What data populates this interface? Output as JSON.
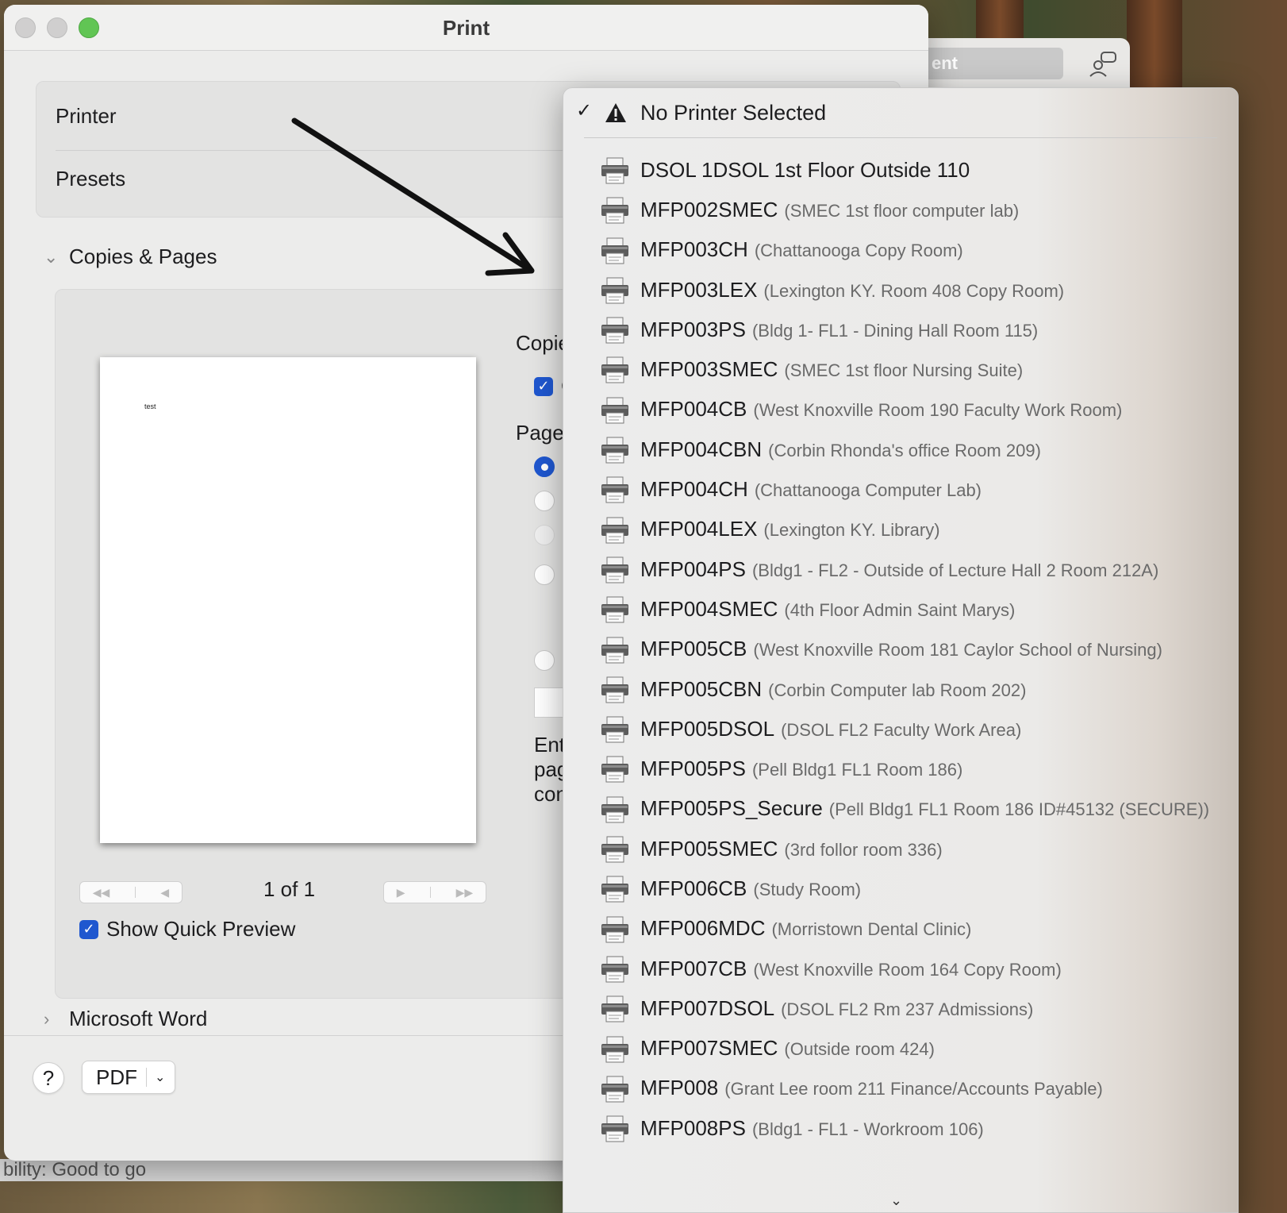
{
  "background": {
    "window_field_text": "ent",
    "status_text": "bility: Good to go"
  },
  "dialog": {
    "title": "Print",
    "printer_label": "Printer",
    "presets_label": "Presets",
    "copies_pages_label": "Copies & Pages",
    "copies_label_partial": "Copie",
    "collate_partial": "C",
    "pages_label_partial": "Pages",
    "enter_text_partial": [
      "Ent",
      "pag",
      "con"
    ],
    "preview_text": "test",
    "page_counter": "1 of 1",
    "show_quick_preview": "Show Quick Preview",
    "microsoft_word_label": "Microsoft Word",
    "help_label": "?",
    "pdf_label": "PDF"
  },
  "menu": {
    "header": "No Printer Selected",
    "items": [
      {
        "name": "DSOL 1DSOL 1st Floor Outside 110",
        "desc": ""
      },
      {
        "name": "MFP002SMEC",
        "desc": "(SMEC 1st floor computer lab)"
      },
      {
        "name": "MFP003CH",
        "desc": "(Chattanooga Copy Room)"
      },
      {
        "name": "MFP003LEX",
        "desc": "(Lexington KY.  Room 408 Copy Room)"
      },
      {
        "name": "MFP003PS",
        "desc": "(Bldg 1- FL1 - Dining Hall Room 115)"
      },
      {
        "name": "MFP003SMEC",
        "desc": "(SMEC 1st floor Nursing Suite)"
      },
      {
        "name": "MFP004CB",
        "desc": "(West Knoxville     Room 190  Faculty Work Room)"
      },
      {
        "name": "MFP004CBN",
        "desc": "(Corbin Rhonda's office Room 209)"
      },
      {
        "name": "MFP004CH",
        "desc": "(Chattanooga Computer Lab)"
      },
      {
        "name": "MFP004LEX",
        "desc": "(Lexington KY.  Library)"
      },
      {
        "name": "MFP004PS",
        "desc": "(Bldg1 - FL2 -  Outside of Lecture Hall 2 Room 212A)"
      },
      {
        "name": "MFP004SMEC",
        "desc": "(4th Floor Admin Saint Marys)"
      },
      {
        "name": "MFP005CB",
        "desc": "(West Knoxville     Room 181  Caylor School of Nursing)"
      },
      {
        "name": "MFP005CBN",
        "desc": "(Corbin Computer lab Room 202)"
      },
      {
        "name": "MFP005DSOL",
        "desc": "(DSOL FL2 Faculty Work Area)"
      },
      {
        "name": "MFP005PS",
        "desc": "(Pell Bldg1 FL1 Room 186)"
      },
      {
        "name": "MFP005PS_Secure",
        "desc": "(Pell Bldg1 FL1 Room 186 ID#45132 (SECURE))"
      },
      {
        "name": "MFP005SMEC",
        "desc": "(3rd follor room 336)"
      },
      {
        "name": "MFP006CB",
        "desc": "(Study Room)"
      },
      {
        "name": "MFP006MDC",
        "desc": "(Morristown Dental Clinic)"
      },
      {
        "name": "MFP007CB",
        "desc": "(West Knoxville     Room 164  Copy Room)"
      },
      {
        "name": "MFP007DSOL",
        "desc": "(DSOL FL2 Rm 237 Admissions)"
      },
      {
        "name": "MFP007SMEC",
        "desc": "(Outside room 424)"
      },
      {
        "name": "MFP008",
        "desc": "(Grant Lee room 211 Finance/Accounts Payable)"
      },
      {
        "name": "MFP008PS",
        "desc": "(Bldg1 - FL1 - Workroom 106)"
      }
    ]
  },
  "colors": {
    "accent": "#1f57cf",
    "window_green": "#61c554"
  },
  "icons": [
    "checkmark-icon",
    "warning-icon",
    "printer-icon",
    "chevron-down-icon",
    "chevron-right-icon",
    "chat-icon"
  ]
}
